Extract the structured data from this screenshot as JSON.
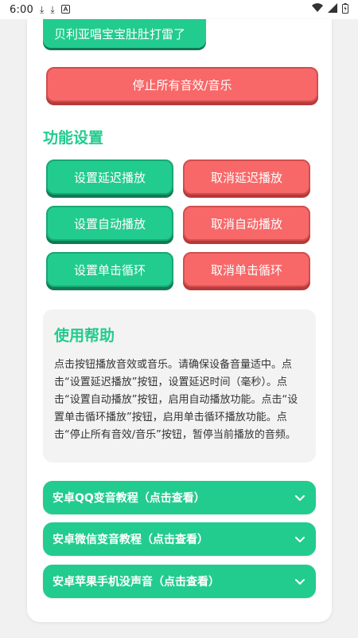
{
  "status_bar": {
    "time": "6:00"
  },
  "top_button": {
    "label": "贝利亚唱宝宝肚肚打雷了"
  },
  "stop_button": {
    "label": "停止所有音效/音乐"
  },
  "settings": {
    "title": "功能设置",
    "set_delay": "设置延迟播放",
    "cancel_delay": "取消延迟播放",
    "set_auto": "设置自动播放",
    "cancel_auto": "取消自动播放",
    "set_loop": "设置单击循环",
    "cancel_loop": "取消单击循环"
  },
  "help": {
    "title": "使用帮助",
    "text": "点击按钮播放音效或音乐。请确保设备音量适中。点击“设置延迟播放”按钮，设置延迟时间（毫秒）。点击“设置自动播放”按钮，启用自动播放功能。点击“设置单击循环播放”按钮，启用单击循环播放功能。点击“停止所有音效/音乐”按钮，暂停当前播放的音频。"
  },
  "tutorials": [
    {
      "label": "安卓QQ变音教程（点击查看）"
    },
    {
      "label": "安卓微信变音教程（点击查看）"
    },
    {
      "label": "安卓苹果手机没声音（点击查看）"
    }
  ],
  "colors": {
    "green": "#22cc8e",
    "red": "#f86868",
    "background": "#f0f1f0"
  }
}
